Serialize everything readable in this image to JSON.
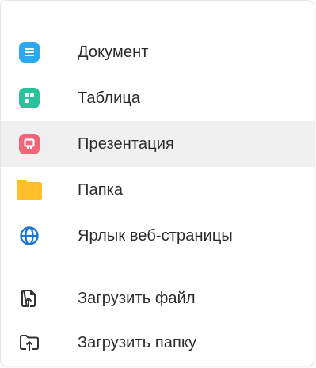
{
  "menu": {
    "items": [
      {
        "label": "Документ",
        "icon": "document-icon",
        "color": "#2aa8f0"
      },
      {
        "label": "Таблица",
        "icon": "spreadsheet-icon",
        "color": "#28c39a"
      },
      {
        "label": "Презентация",
        "icon": "presentation-icon",
        "color": "#f2647a",
        "highlighted": true
      },
      {
        "label": "Папка",
        "icon": "folder-icon",
        "color": "#ffbf2a"
      },
      {
        "label": "Ярлык веб-страницы",
        "icon": "globe-icon",
        "color": "#1a73d9"
      }
    ],
    "upload_items": [
      {
        "label": "Загрузить файл",
        "icon": "upload-file-icon"
      },
      {
        "label": "Загрузить папку",
        "icon": "upload-folder-icon"
      }
    ]
  }
}
